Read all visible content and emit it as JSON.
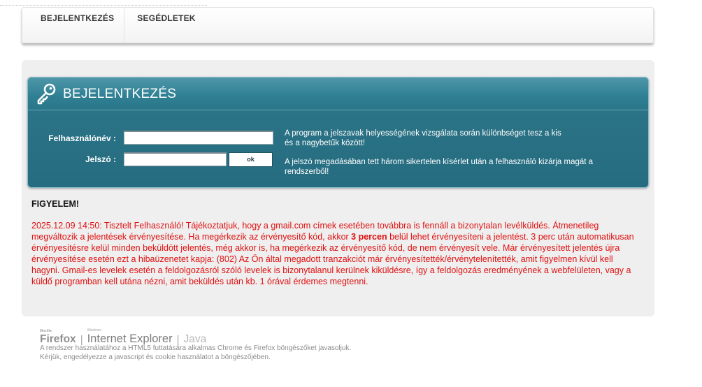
{
  "nav": {
    "items": [
      {
        "label": "BEJELENTKEZÉS"
      },
      {
        "label": "SEGÉDLETEK"
      }
    ]
  },
  "login": {
    "title": "BEJELENTKEZÉS",
    "username_label": "Felhasználónév   :",
    "password_label": "Jelszó   :",
    "username_value": "",
    "password_value": "",
    "ok_label": "ok",
    "hint_1": "A program a jelszavak helyességének vizsgálata során különbséget tesz a kis és a nagybetűk között!",
    "hint_2": "A jelszó megadásában tett három sikertelen kísérlet után a felhasználó kizárja magát a rendszerből!"
  },
  "notice": {
    "title": "FIGYELEM!",
    "text_before": "2025.12.09 14:50: Tisztelt Felhasználó! Tájékoztatjuk, hogy a gmail.com címek esetében továbbra is fennáll a bizonytalan levélküldés. Átmenetileg megváltozik a jelentések érvényesítése. Ha megérkezik az érvényesítő kód, akkor ",
    "text_bold": "3 percen",
    "text_after": " belül lehet érvényesíteni a jelentést. 3 perc után automatikusan érvényesítésre kelül minden beküldött jelentés, még akkor is, ha megérkezik az érvényesítő kód, de nem érvényesít vele. Már érvényesített jelentés újra érvényesítése esetén ezt a hibaüzenetet kapja: (802) Az Ön által megadott tranzakciót már érvényesítették/érvénytelenítették, amit figyelmen kívül kell hagyni. Gmail-es levelek esetén a feldolgozásról szóló levelek is bizonytalanul kerülnek kiküldésre, így a feldolgozás eredményének a webfelületen, vagy a küldő programban kell utána nézni, amit beküldés után kb. 1 órával érdemes megtenni."
  },
  "footer": {
    "firefox_small": "Mozilla",
    "firefox": "Firefox",
    "ie_small": "Windows",
    "ie": "Internet Explorer",
    "java": "Java",
    "line_1": "A rendszer használatához a HTML5 futtatására alkalmas Chrome és Firefox böngészőket javasoljuk.",
    "line_2": "Kérjük, engedélyezze a javascript és cookie használatot a böngészőjében."
  },
  "colors": {
    "accent": "#2f7a8d",
    "warning": "#e01010"
  }
}
